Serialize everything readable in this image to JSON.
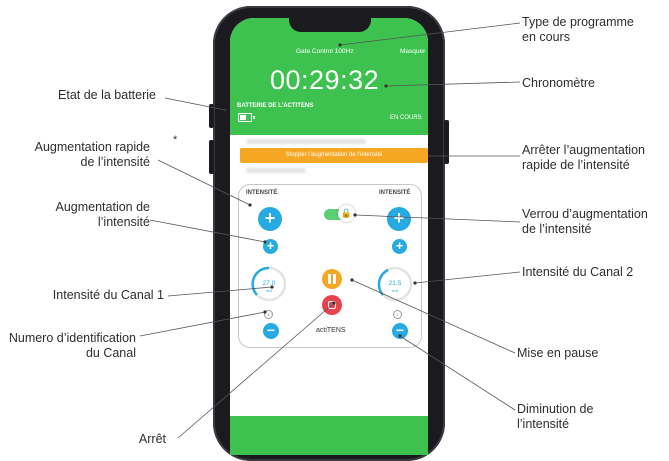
{
  "annotations": {
    "left": {
      "battery": "Etat de la batterie",
      "fast_increase": [
        "Augmentation rapide",
        "de l’intensité"
      ],
      "increase": [
        "Augmentation de",
        "l’intensité"
      ],
      "channel1": "Intensité du Canal 1",
      "channel_id": [
        "Numero d’identification",
        "du Canal"
      ],
      "stop": "Arrêt"
    },
    "right": {
      "program_type": [
        "Type de programme",
        "en cours"
      ],
      "timer": "Chronomètre",
      "stop_fast_increase": [
        "Arrêter l’augmentation",
        "rapide de l’intensité"
      ],
      "increase_lock": [
        "Verrou d’augmentation",
        "de l’intensité"
      ],
      "channel2": "Intensité du Canal 2",
      "pause": "Mise en pause",
      "decrease": [
        "Diminution de",
        "l’intensité"
      ]
    },
    "footnote_mark": "*"
  },
  "screen": {
    "program": "Gate Control 100Hz",
    "hide_button": "Masquer",
    "timer": "00:29:32",
    "battery_title": "BATTERIE DE L’ACTITENS",
    "status": "EN COURS",
    "stop_fast_button": "Stopper l’augmentation de l’intensité",
    "intensity_label_left": "INTENSITÉ",
    "intensity_label_right": "INTENSITÉ",
    "channel1_value": "27.0",
    "channel2_value": "21.5",
    "unit": "mA",
    "brand": "actiTENS",
    "channel1_id": "1",
    "channel2_id": "2",
    "plus_symbol": "+",
    "minus_symbol": "−",
    "lock_symbol": "🔒"
  },
  "colors": {
    "header_green": "#3ec24f",
    "accent_blue": "#27a9e1",
    "orange": "#f5a623",
    "red": "#e8434c"
  }
}
